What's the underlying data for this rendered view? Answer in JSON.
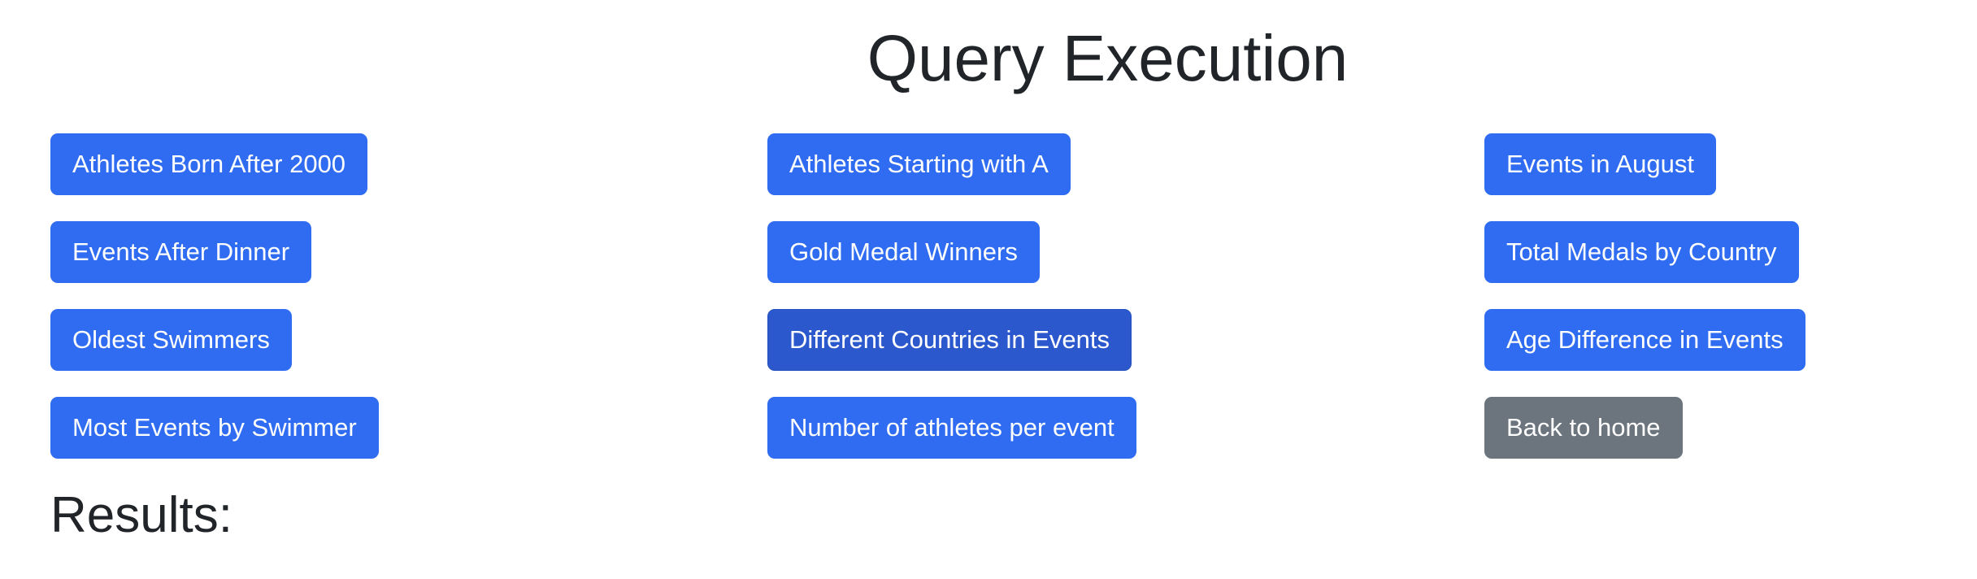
{
  "page": {
    "title": "Query Execution",
    "results_heading": "Results:"
  },
  "queries": [
    {
      "label": "Athletes Born After 2000"
    },
    {
      "label": "Athletes Starting with A"
    },
    {
      "label": "Events in August"
    },
    {
      "label": "Events After Dinner"
    },
    {
      "label": "Gold Medal Winners"
    },
    {
      "label": "Total Medals by Country"
    },
    {
      "label": "Oldest Swimmers"
    },
    {
      "label": "Different Countries in Events"
    },
    {
      "label": "Age Difference in Events"
    },
    {
      "label": "Most Events by Swimmer"
    },
    {
      "label": "Number of athletes per event"
    }
  ],
  "back_button": {
    "label": "Back to home"
  },
  "colors": {
    "primary": "#2f6cf1",
    "primary_active": "#2b58cc",
    "secondary": "#6c757d",
    "text": "#212529"
  }
}
